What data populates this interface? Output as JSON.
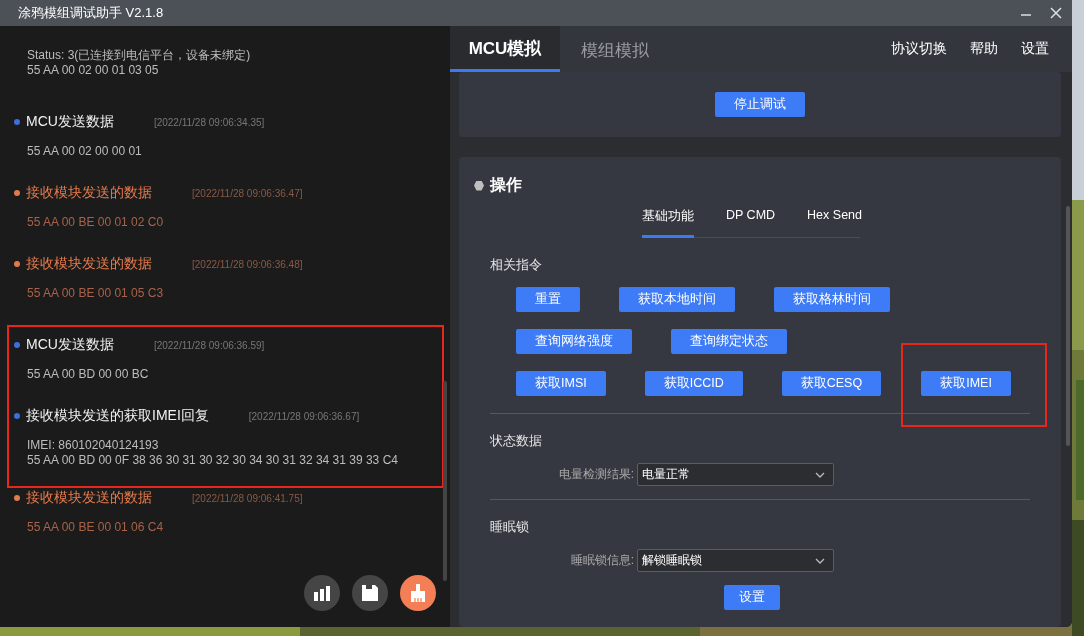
{
  "window": {
    "title": "涂鸦模组调试助手 V2.1.8"
  },
  "log": {
    "entries": [
      {
        "kind": "reply",
        "lines": [
          "Status: 3(已连接到电信平台，设备未绑定)",
          "55 AA 00 02 00 01 03 05"
        ],
        "highlighted": false
      },
      {
        "kind": "send",
        "title": "MCU发送数据",
        "time": "[2022/11/28 09:06:34.35]",
        "lines": [
          "55 AA 00 02 00 00 01"
        ],
        "highlighted": false
      },
      {
        "kind": "receive",
        "title": "接收模块发送的数据",
        "time": "[2022/11/28 09:06:36.47]",
        "lines": [
          "55 AA 00 BE 00 01 02 C0"
        ],
        "highlighted": false
      },
      {
        "kind": "receive",
        "title": "接收模块发送的数据",
        "time": "[2022/11/28 09:06:36.48]",
        "lines": [
          "55 AA 00 BE 00 01 05 C3"
        ],
        "highlighted": false
      },
      {
        "kind": "send",
        "title": "MCU发送数据",
        "time": "[2022/11/28 09:06:36.59]",
        "lines": [
          "55 AA 00 BD 00 00 BC"
        ],
        "highlighted": true
      },
      {
        "kind": "reply",
        "title": "接收模块发送的获取IMEI回复",
        "time": "[2022/11/28 09:06:36.67]",
        "lines": [
          "IMEI: 860102040124193",
          "55 AA 00 BD 00 0F 38 36 30 31 30 32 30 34 30 31 32 34 31 39 33 C4"
        ],
        "highlighted": true
      },
      {
        "kind": "receive",
        "title": "接收模块发送的数据",
        "time": "[2022/11/28 09:06:41.75]",
        "lines": [
          "55 AA 00 BE 00 01 06 C4"
        ],
        "highlighted": false
      }
    ],
    "actions": [
      {
        "kind": "chart"
      },
      {
        "kind": "save"
      },
      {
        "kind": "clear"
      }
    ]
  },
  "tabs": [
    {
      "label": "MCU模拟",
      "selected": true
    },
    {
      "label": "模组模拟",
      "selected": false
    }
  ],
  "menu": [
    "协议切换",
    "帮助",
    "设置"
  ],
  "debug_panel": {
    "button": "停止调试"
  },
  "operation": {
    "title": "操作",
    "tabs": [
      {
        "label": "基础功能",
        "selected": true
      },
      {
        "label": "DP CMD",
        "selected": false
      },
      {
        "label": "Hex Send",
        "selected": false
      }
    ],
    "commands_title": "相关指令",
    "command_rows": [
      [
        {
          "label": "重置",
          "highlighted": false
        },
        {
          "label": "获取本地时间",
          "highlighted": false
        },
        {
          "label": "获取格林时间",
          "highlighted": false
        }
      ],
      [
        {
          "label": "查询网络强度",
          "highlighted": false
        },
        {
          "label": "查询绑定状态",
          "highlighted": false
        }
      ],
      [
        {
          "label": "获取IMSI",
          "highlighted": false
        },
        {
          "label": "获取ICCID",
          "highlighted": false
        },
        {
          "label": "获取CESQ",
          "highlighted": false
        },
        {
          "label": "获取IMEI",
          "highlighted": true
        }
      ]
    ],
    "sections": [
      {
        "title": "状态数据",
        "label": "电量检测结果:",
        "value": "电量正常"
      },
      {
        "title": "睡眠锁",
        "label": "睡眠锁信息:",
        "value": "解锁睡眠锁",
        "button": "设置"
      }
    ]
  }
}
